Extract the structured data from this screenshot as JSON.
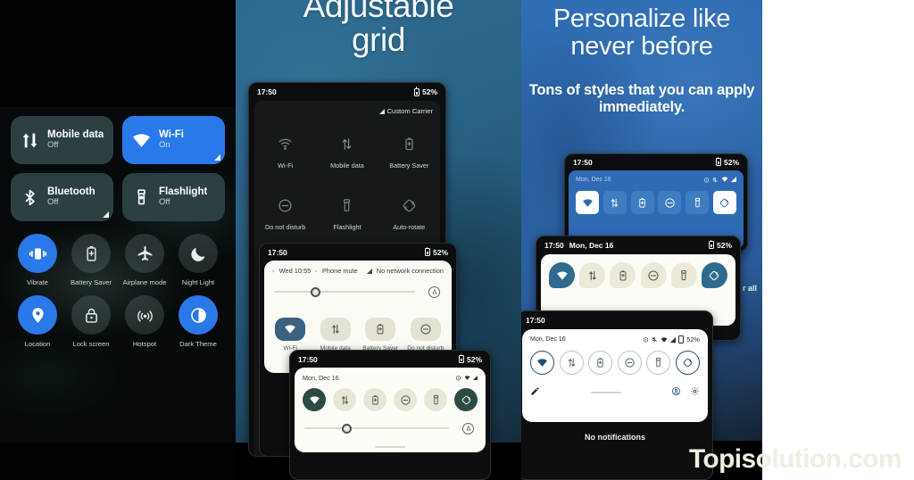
{
  "watermark": "Topisolution.com",
  "panel_left": {
    "name": "quick-settings-dark-preview",
    "big_tiles": [
      {
        "icon": "mobile-data-icon",
        "title": "Mobile data",
        "subtitle": "Off",
        "active": false,
        "expand": false
      },
      {
        "icon": "wifi-icon",
        "title": "Wi-Fi",
        "subtitle": "On",
        "active": true,
        "expand": true
      },
      {
        "icon": "bluetooth-icon",
        "title": "Bluetooth",
        "subtitle": "Off",
        "active": false,
        "expand": true
      },
      {
        "icon": "flashlight-icon",
        "title": "Flashlight",
        "subtitle": "Off",
        "active": false,
        "expand": false
      }
    ],
    "circle_tiles": [
      {
        "icon": "vibrate-icon",
        "label": "Vibrate",
        "active": true
      },
      {
        "icon": "battery-saver-icon",
        "label": "Battery Saver",
        "active": false
      },
      {
        "icon": "airplane-icon",
        "label": "Airplane mode",
        "active": false
      },
      {
        "icon": "night-light-icon",
        "label": "Night Light",
        "active": false
      },
      {
        "icon": "location-icon",
        "label": "Location",
        "active": true
      },
      {
        "icon": "lock-icon",
        "label": "Lock screen",
        "active": false
      },
      {
        "icon": "hotspot-icon",
        "label": "Hotspot",
        "active": false
      },
      {
        "icon": "dark-theme-icon",
        "label": "Dark Theme",
        "active": true
      }
    ]
  },
  "panel_mid": {
    "headline_line1": "Adjustable",
    "headline_line2": "grid",
    "phone_dark_grid": {
      "time": "17:50",
      "battery": "52%",
      "carrier": "Custom Carrier",
      "tiles": [
        {
          "icon": "wifi-icon",
          "label": "Wi-Fi"
        },
        {
          "icon": "mobile-data-icon",
          "label": "Mobile data"
        },
        {
          "icon": "battery-saver-icon",
          "label": "Battery Saver"
        },
        {
          "icon": "dnd-icon",
          "label": "Do not disturb"
        },
        {
          "icon": "flashlight-icon",
          "label": "Flashlight"
        },
        {
          "icon": "auto-rotate-icon",
          "label": "Auto-rotate"
        }
      ]
    },
    "phone_light": {
      "time": "17:50",
      "battery": "52%",
      "alarm": "Wed 10:55",
      "mute": "Phone mute",
      "network": "No network connection",
      "tiles": [
        {
          "icon": "wifi-icon",
          "label": "Wi-Fi",
          "active": true
        },
        {
          "icon": "mobile-data-icon",
          "label": "Mobile data",
          "active": false
        },
        {
          "icon": "battery-saver-icon",
          "label": "Battery Saver",
          "active": false
        },
        {
          "icon": "dnd-icon",
          "label": "Do not disturb",
          "active": false
        }
      ]
    },
    "phone_cream": {
      "time": "17:50",
      "battery": "52%",
      "date": "Mon, Dec 16",
      "tiles": [
        {
          "icon": "wifi-icon",
          "active": true
        },
        {
          "icon": "mobile-data-icon",
          "active": false
        },
        {
          "icon": "battery-saver-icon",
          "active": false
        },
        {
          "icon": "dnd-icon",
          "active": false
        },
        {
          "icon": "flashlight-icon",
          "active": false
        },
        {
          "icon": "auto-rotate-icon",
          "active": true
        }
      ]
    }
  },
  "panel_right": {
    "headline": "Personalize like never before",
    "subhead": "Tons of styles that you can apply immediately.",
    "phone_blue": {
      "time": "17:50",
      "battery": "52%",
      "date": "Mon, Dec 16",
      "tiles": [
        {
          "icon": "wifi-icon",
          "active": true
        },
        {
          "icon": "mobile-data-icon",
          "active": false
        },
        {
          "icon": "battery-saver-icon",
          "active": false
        },
        {
          "icon": "dnd-icon",
          "active": false
        },
        {
          "icon": "flashlight-icon",
          "active": false
        },
        {
          "icon": "auto-rotate-icon",
          "active": true
        }
      ]
    },
    "phone_teardrop": {
      "time": "17:50",
      "date": "Mon, Dec 16",
      "battery": "52%",
      "tiles": [
        {
          "icon": "wifi-icon",
          "active": true
        },
        {
          "icon": "mobile-data-icon",
          "active": false
        },
        {
          "icon": "battery-saver-icon",
          "active": false
        },
        {
          "icon": "dnd-icon",
          "active": false
        },
        {
          "icon": "flashlight-icon",
          "active": false
        },
        {
          "icon": "auto-rotate-icon",
          "active": true
        }
      ]
    },
    "phone_outline": {
      "time": "17:50",
      "date": "Mon, Dec 16",
      "battery": "52%",
      "no_notifications": "No notifications",
      "tiles": [
        {
          "icon": "wifi-icon",
          "active": true
        },
        {
          "icon": "mobile-data-icon",
          "active": false
        },
        {
          "icon": "battery-saver-icon",
          "active": false
        },
        {
          "icon": "dnd-icon",
          "active": false
        },
        {
          "icon": "flashlight-icon",
          "active": false
        },
        {
          "icon": "auto-rotate-icon",
          "active": true
        }
      ]
    },
    "behind_text": "r all"
  },
  "colors": {
    "accent_blue": "#2979e8",
    "tile_dark": "#2c4042",
    "panel_blue": "#2f6bb4",
    "cream": "#ece9d8"
  }
}
